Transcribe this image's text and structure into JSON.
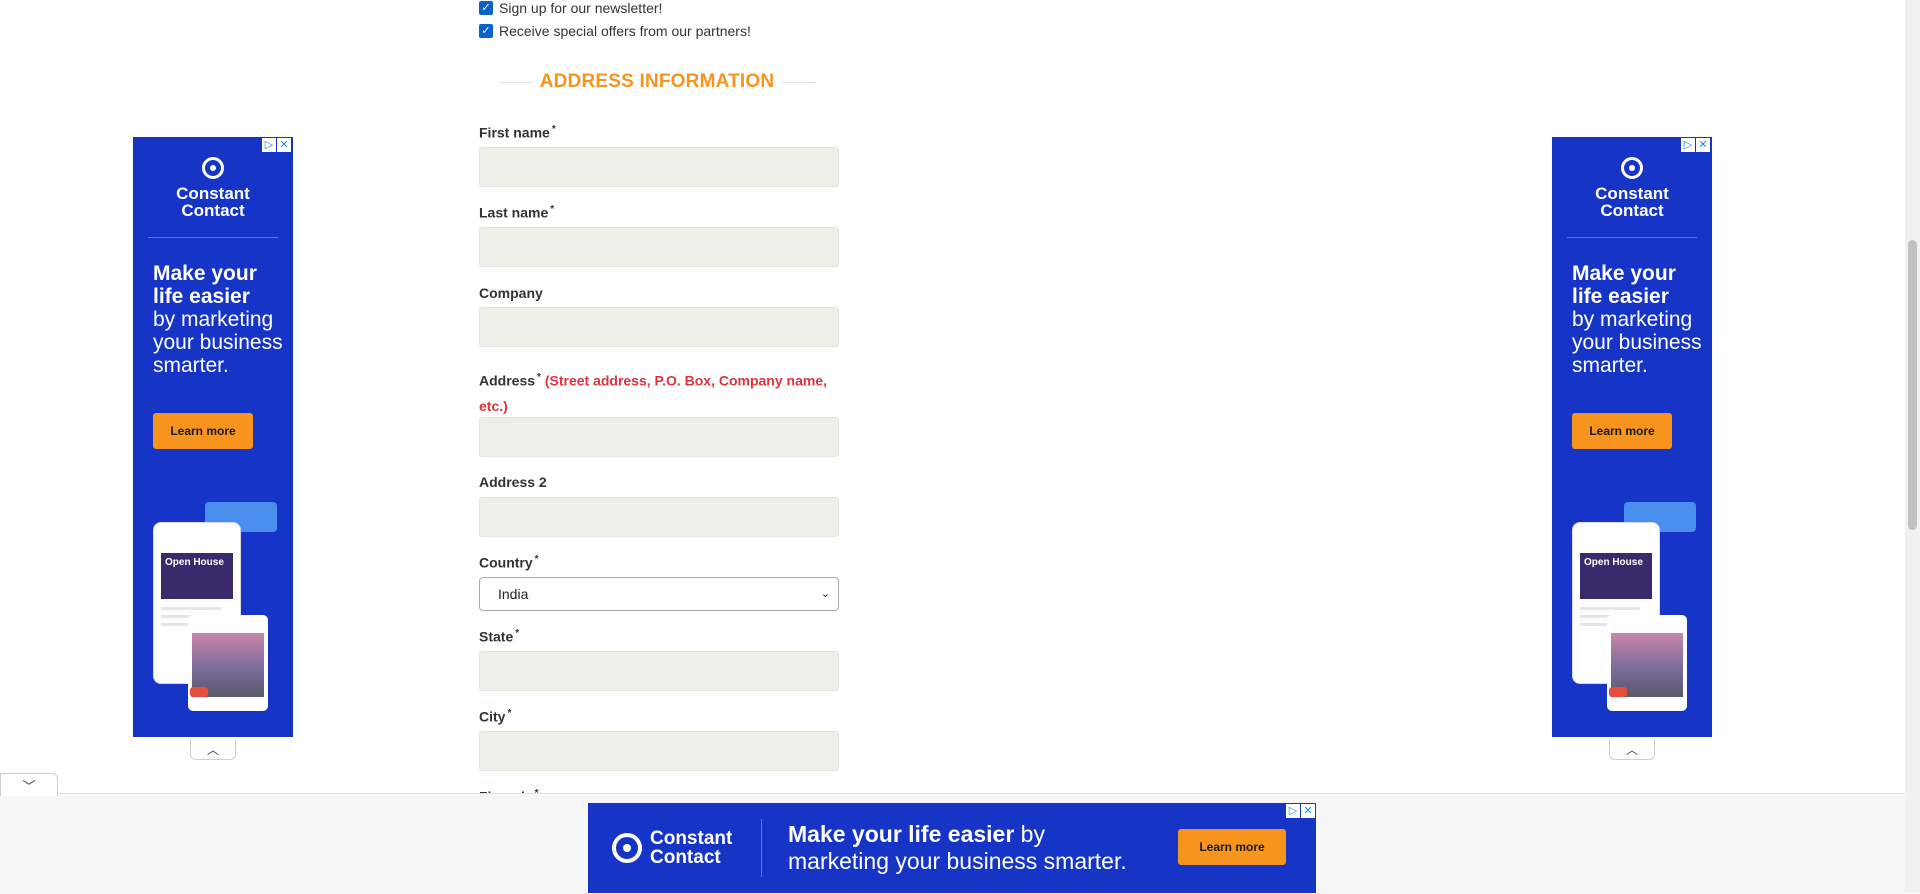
{
  "preferences": {
    "newsletter_label": "Sign up for our newsletter!",
    "partners_label": "Receive special offers from our partners!"
  },
  "address_section": {
    "title": "ADDRESS INFORMATION",
    "required_mark": "*",
    "first_name_label": "First name",
    "last_name_label": "Last name",
    "company_label": "Company",
    "address_label": "Address",
    "address_hint": "(Street address, P.O. Box, Company name, etc.)",
    "address2_label": "Address 2",
    "country_label": "Country",
    "country_value": "India",
    "state_label": "State",
    "city_label": "City",
    "zipcode_label": "Zipcode"
  },
  "ads": {
    "brand_line1": "Constant",
    "brand_line2": "Contact",
    "headline_bold": "Make your life easier",
    "headline_rest": "by marketing your business smarter.",
    "cta": "Learn more",
    "phone_card_text": "Open House",
    "banner_bold": "Make your life easier",
    "banner_rest_1": " by",
    "banner_rest_2": "marketing your business smarter.",
    "ad_choices_icon": "▷",
    "close_icon": "✕"
  },
  "colors": {
    "accent": "#f7941d",
    "required_hint": "#e0323c",
    "ad_blue": "#1634c6",
    "checkbox": "#0b63ce"
  }
}
